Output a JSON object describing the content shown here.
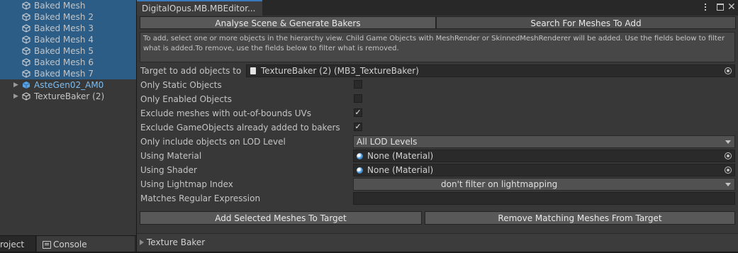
{
  "hierarchy": {
    "items": [
      {
        "label": "Baked Mesh",
        "selected": true,
        "icon": "cube-icon"
      },
      {
        "label": "Baked Mesh 2",
        "selected": true,
        "icon": "cube-icon"
      },
      {
        "label": "Baked Mesh 3",
        "selected": true,
        "icon": "cube-icon"
      },
      {
        "label": "Baked Mesh 4",
        "selected": true,
        "icon": "cube-icon"
      },
      {
        "label": "Baked Mesh 5",
        "selected": true,
        "icon": "cube-icon"
      },
      {
        "label": "Baked Mesh 6",
        "selected": true,
        "icon": "cube-icon"
      },
      {
        "label": "Baked Mesh 7",
        "selected": true,
        "icon": "cube-icon"
      },
      {
        "label": "AsteGen02_AM0",
        "selected": false,
        "icon": "prefab-cube-icon",
        "has_children": true
      },
      {
        "label": "TextureBaker (2)",
        "selected": false,
        "icon": "cube-icon",
        "has_children": true
      }
    ]
  },
  "bottom_tabs": {
    "project": "roject",
    "console": "Console"
  },
  "window": {
    "tab_title": "DigitalOpus.MB.MBEditor...",
    "menu_icon": "kebab-menu-icon",
    "maximize_icon": "maximize-icon",
    "close_icon": "close-icon"
  },
  "toolbar": {
    "analyse_label": "Analyse Scene & Generate Bakers",
    "search_label": "Search For Meshes To Add",
    "active_tab": "Search For Meshes To Add"
  },
  "help_text": "To add, select one or more objects in the hierarchy view. Child Game Objects with MeshRender or SkinnedMeshRenderer will be added. Use the fields below to filter what is added.To remove, use the fields below to filter what is removed.",
  "fields": {
    "target_label": "Target to add objects to",
    "target_value": "TextureBaker (2) (MB3_TextureBaker)",
    "only_static_label": "Only Static Objects",
    "only_static_checked": false,
    "only_enabled_label": "Only Enabled Objects",
    "only_enabled_checked": false,
    "exclude_uv_label": "Exclude meshes with out-of-bounds UVs",
    "exclude_uv_checked": true,
    "exclude_added_label": "Exclude GameObjects already added to bakers",
    "exclude_added_checked": true,
    "lod_label": "Only include objects on LOD Level",
    "lod_value": "All LOD Levels",
    "material_label": "Using Material",
    "material_value": "None (Material)",
    "shader_label": "Using Shader",
    "shader_value": "None (Material)",
    "lightmap_label": "Using Lightmap Index",
    "lightmap_value": "don't filter on lightmapping",
    "regex_label": "Matches Regular Expression",
    "regex_value": ""
  },
  "actions": {
    "add_label": "Add Selected Meshes To Target",
    "remove_label": "Remove Matching Meshes From Target"
  },
  "foldout": {
    "label": "Texture Baker",
    "expanded": false
  },
  "colors": {
    "selection": "#2c5d87",
    "prefab_text": "#7dbdf1",
    "active_tab_accent": "#3a79bb"
  }
}
